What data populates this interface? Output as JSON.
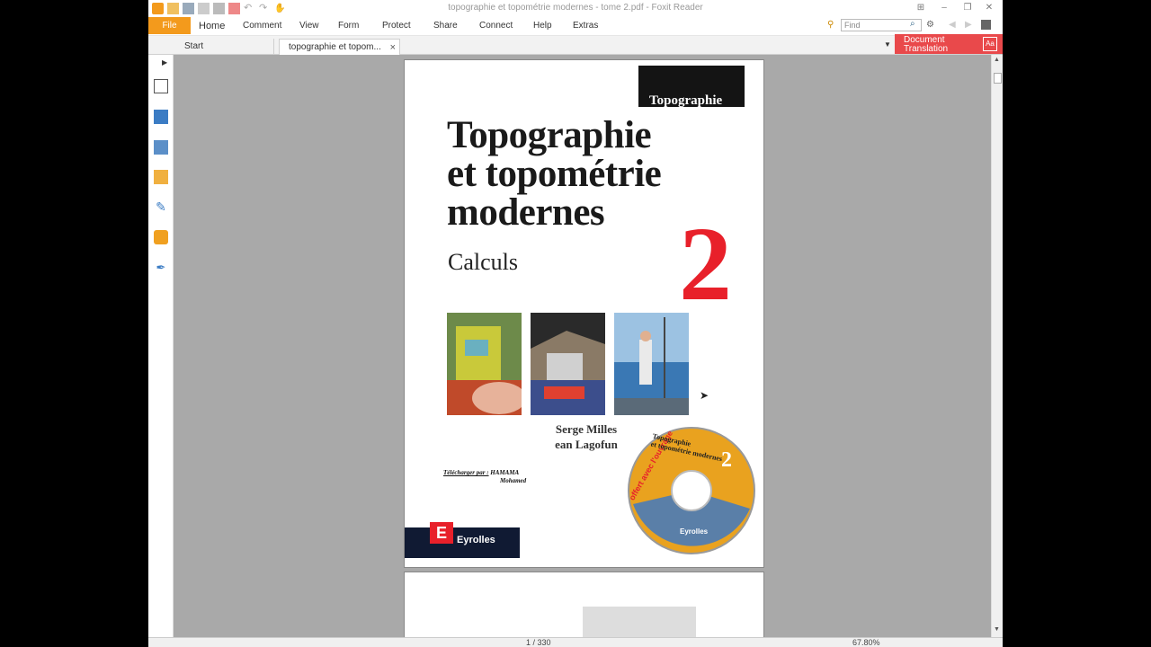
{
  "window": {
    "title": "topographie et topométrie modernes - tome 2.pdf - Foxit Reader"
  },
  "ribbon": {
    "file_label": "File",
    "tabs": [
      "Home",
      "Comment",
      "View",
      "Form",
      "Protect",
      "Share",
      "Connect",
      "Help",
      "Extras"
    ],
    "find_placeholder": "Find"
  },
  "doc_tabs": {
    "start_label": "Start",
    "doc_label": "topographie et topom...",
    "close_label": "×"
  },
  "translate_label_1": "Document",
  "translate_label_2": "Translation",
  "cover": {
    "badge": "Topographie",
    "title_lines": [
      "Topographie",
      "et topométrie",
      "modernes"
    ],
    "subtitle": "Calculs",
    "volume_number": "2",
    "authors": [
      "Serge Milles",
      "ean Lagofun"
    ],
    "download_label": "Télécharger par :",
    "download_name_1": "HAMAMA",
    "download_name_2": "Mohamed",
    "publisher": "Eyrolles",
    "publisher_logo_letter": "E",
    "cd_arc_text": "offert avec l'ouvrage",
    "cd_title_1": "Topographie",
    "cd_title_2": "et topométrie modernes",
    "cd_number": "2",
    "cd_publisher": "Eyrolles"
  },
  "status": {
    "page_indicator": "1 / 330",
    "zoom": "67.80%"
  },
  "colors": {
    "file_orange": "#f39a1c",
    "translate_red": "#e9494b",
    "cover_red": "#e8202a",
    "doc_background": "#a9a9a9"
  }
}
